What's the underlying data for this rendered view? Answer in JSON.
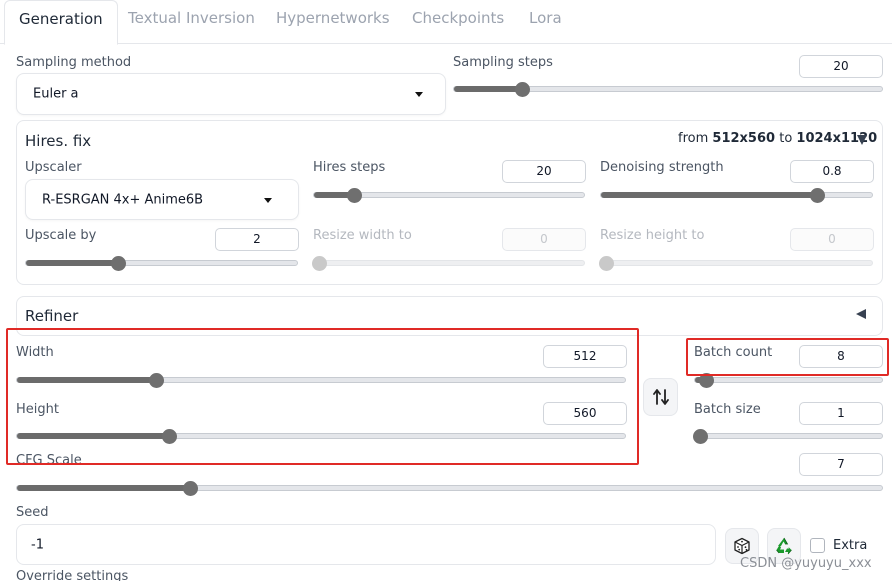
{
  "tabs": [
    "Generation",
    "Textual Inversion",
    "Hypernetworks",
    "Checkpoints",
    "Lora"
  ],
  "sampling_method": {
    "label": "Sampling method",
    "value": "Euler a"
  },
  "sampling_steps": {
    "label": "Sampling steps",
    "value": "20",
    "level": 0.16
  },
  "hires": {
    "title": "Hires. fix",
    "from_label": "from",
    "from_value": "512x560",
    "to_label": "to",
    "to_value": "1024x1120",
    "upscaler": {
      "label": "Upscaler",
      "value": "R-ESRGAN 4x+ Anime6B"
    },
    "hires_steps": {
      "label": "Hires steps",
      "value": "20",
      "level": 0.15
    },
    "denoising": {
      "label": "Denoising strength",
      "value": "0.8",
      "level": 0.8
    },
    "upscale_by": {
      "label": "Upscale by",
      "value": "2",
      "level": 0.34
    },
    "resize_width": {
      "label": "Resize width to",
      "value": "0",
      "level": 0
    },
    "resize_height": {
      "label": "Resize height to",
      "value": "0",
      "level": 0
    }
  },
  "refiner": {
    "title": "Refiner"
  },
  "width": {
    "label": "Width",
    "value": "512",
    "level": 0.23
  },
  "height": {
    "label": "Height",
    "value": "560",
    "level": 0.25
  },
  "swap_icon": "swap-vertical-arrows-icon",
  "batch_count": {
    "label": "Batch count",
    "value": "8",
    "level": 0.06
  },
  "batch_size": {
    "label": "Batch size",
    "value": "1",
    "level": 0
  },
  "cfg_scale": {
    "label": "CFG Scale",
    "value": "7",
    "level": 0.2
  },
  "seed": {
    "label": "Seed",
    "value": "-1"
  },
  "seed_icons": [
    "dice-icon",
    "recycle-icon"
  ],
  "extra_label": "Extra",
  "override_label": "Override settings",
  "watermark": "CSDN @yuyuyu_xxx",
  "colors": {
    "highlight": "#e02a26",
    "slider_fill": "#6b6b6b"
  }
}
